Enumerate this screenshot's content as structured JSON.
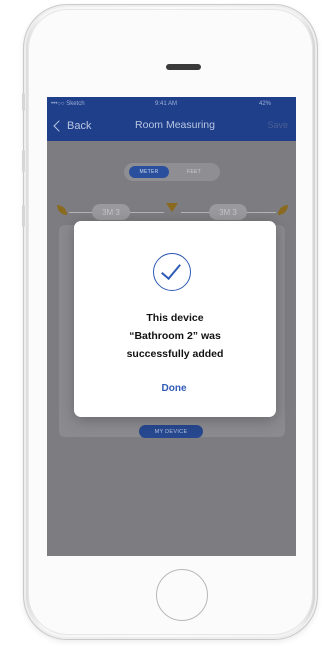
{
  "status_bar": {
    "carrier": "•••○○ Sketch",
    "time": "9:41 AM",
    "battery": "42%"
  },
  "nav": {
    "back_label": "Back",
    "title": "Room Measuring",
    "save_label": "Save"
  },
  "unit_toggle": {
    "options": [
      "METER",
      "FEET"
    ],
    "selected": "METER"
  },
  "measurements": {
    "left": "3M 3",
    "right": "3M 3"
  },
  "my_device_label": "MY DEVICE",
  "modal": {
    "line1": "This device",
    "line2": "“Bathroom 2” was",
    "line3": "successfully added",
    "done_label": "Done"
  },
  "colors": {
    "accent": "#2f5bb7",
    "nav_background": "#1f3f8a",
    "dim_overlay": "#7d7d81"
  },
  "icons": [
    "chevron-left-icon",
    "check-circle-icon",
    "leaf-icon"
  ]
}
